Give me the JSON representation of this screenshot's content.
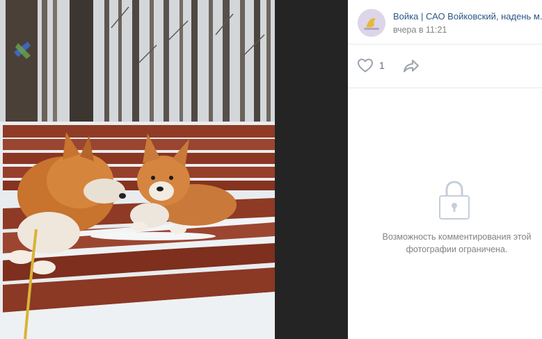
{
  "post": {
    "author": "Войка | САО Войковский, надень м...",
    "time": "вчера в 11:21"
  },
  "actions": {
    "like_count": "1"
  },
  "comments": {
    "disabled_line1": "Возможность комментирования этой",
    "disabled_line2": "фотографии ограничена."
  },
  "icons": {
    "like": "heart-outline-icon",
    "share": "share-arrow-icon",
    "lock": "lock-icon"
  },
  "colors": {
    "link": "#2a5885",
    "muted": "#828282",
    "icon": "#99a2ad",
    "viewer_bg": "#242424"
  }
}
